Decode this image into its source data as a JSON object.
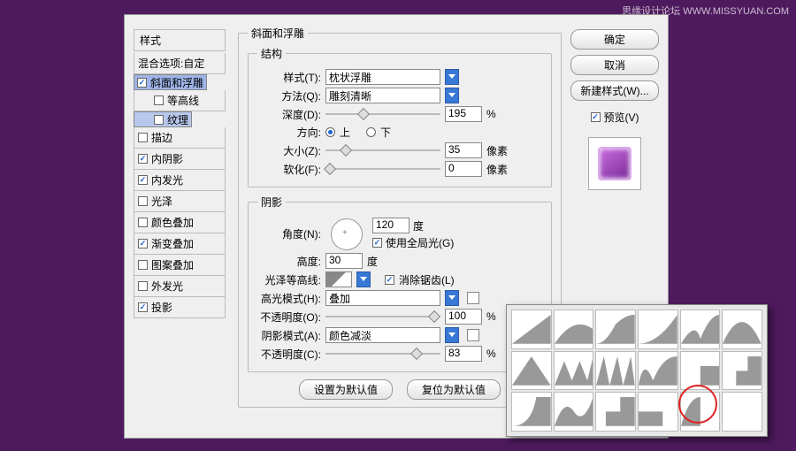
{
  "watermark": "思缘设计论坛  WWW.MISSYUAN.COM",
  "sidebar": {
    "header": "样式",
    "blend": "混合选项:自定",
    "items": [
      {
        "label": "斜面和浮雕",
        "on": true,
        "sel": true
      },
      {
        "label": "等高线",
        "on": false,
        "sel": false,
        "sub": true
      },
      {
        "label": "纹理",
        "on": false,
        "sel": true,
        "sub": true
      },
      {
        "label": "描边",
        "on": false
      },
      {
        "label": "内阴影",
        "on": true
      },
      {
        "label": "内发光",
        "on": true
      },
      {
        "label": "光泽",
        "on": false
      },
      {
        "label": "颜色叠加",
        "on": false
      },
      {
        "label": "渐变叠加",
        "on": true
      },
      {
        "label": "图案叠加",
        "on": false
      },
      {
        "label": "外发光",
        "on": false
      },
      {
        "label": "投影",
        "on": true
      }
    ]
  },
  "panel": {
    "title": "斜面和浮雕",
    "structure": {
      "legend": "结构",
      "style_lbl": "样式(T):",
      "style_val": "枕状浮雕",
      "tech_lbl": "方法(Q):",
      "tech_val": "雕刻清晰",
      "depth_lbl": "深度(D):",
      "depth_val": "195",
      "depth_unit": "%",
      "dir_lbl": "方向:",
      "dir_up": "上",
      "dir_down": "下",
      "size_lbl": "大小(Z):",
      "size_val": "35",
      "size_unit": "像素",
      "soft_lbl": "软化(F):",
      "soft_val": "0",
      "soft_unit": "像素"
    },
    "shade": {
      "legend": "阴影",
      "angle_lbl": "角度(N):",
      "angle_val": "120",
      "angle_unit": "度",
      "global": "使用全局光(G)",
      "alt_lbl": "高度:",
      "alt_val": "30",
      "alt_unit": "度",
      "gloss_lbl": "光泽等高线:",
      "aa": "消除锯齿(L)",
      "hl_mode_lbl": "高光模式(H):",
      "hl_mode_val": "叠加",
      "hl_op_lbl": "不透明度(O):",
      "hl_op_val": "100",
      "hl_op_unit": "%",
      "sh_mode_lbl": "阴影模式(A):",
      "sh_mode_val": "颜色减淡",
      "sh_op_lbl": "不透明度(C):",
      "sh_op_val": "83",
      "sh_op_unit": "%"
    },
    "defaults": "设置为默认值",
    "reset": "复位为默认值"
  },
  "right": {
    "ok": "确定",
    "cancel": "取消",
    "newstyle": "新建样式(W)...",
    "preview": "预览(V)"
  }
}
